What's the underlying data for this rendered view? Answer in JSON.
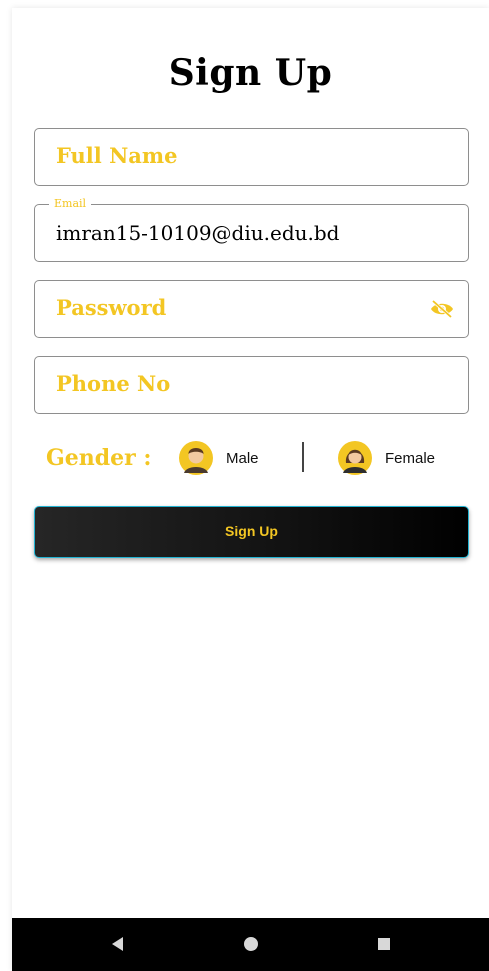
{
  "page": {
    "title": "Sign Up"
  },
  "form": {
    "full_name": {
      "placeholder": "Full Name",
      "value": ""
    },
    "email": {
      "label": "Email",
      "value": "imran15-10109@diu.edu.bd"
    },
    "password": {
      "placeholder": "Password",
      "value": "",
      "visibility_icon": "eye-off-icon"
    },
    "phone": {
      "placeholder": "Phone No",
      "value": ""
    }
  },
  "gender": {
    "label": "Gender :",
    "options": [
      {
        "label": "Male",
        "icon": "male-avatar-icon"
      },
      {
        "label": "Female",
        "icon": "female-avatar-icon"
      }
    ]
  },
  "actions": {
    "submit_label": "Sign Up"
  },
  "navigation": {
    "buttons": [
      "back-icon",
      "home-icon",
      "recents-icon"
    ]
  },
  "colors": {
    "accent": "#f3c623",
    "button_border": "#22b3d2",
    "button_bg": "#111111",
    "navbar": "#000000"
  }
}
